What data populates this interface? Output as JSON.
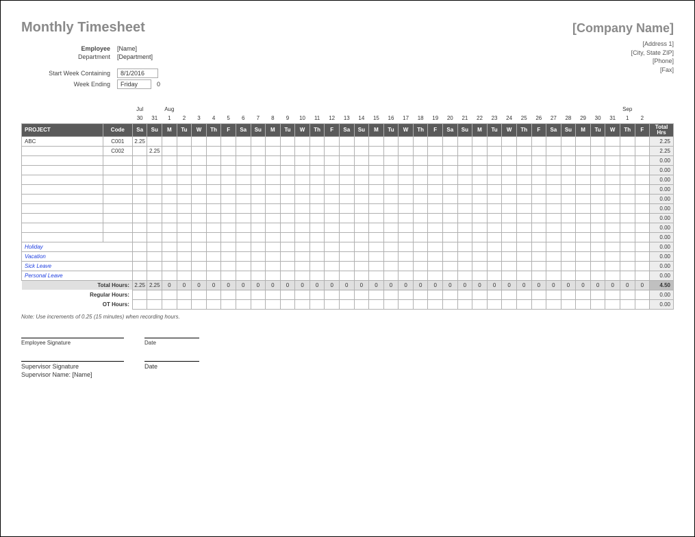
{
  "title": "Monthly Timesheet",
  "company": {
    "name": "[Company Name]",
    "address1": "[Address 1]",
    "citystatezip": "[City, State ZIP]",
    "phone": "[Phone]",
    "fax": "[Fax]"
  },
  "employee": {
    "label": "Employee",
    "value": "[Name]"
  },
  "department": {
    "label": "Department",
    "value": "[Department]"
  },
  "start_week": {
    "label": "Start Week Containing",
    "value": "8/1/2016"
  },
  "week_ending": {
    "label": "Week Ending",
    "value": "Friday",
    "extra": "0"
  },
  "months": {
    "jul": "Jul",
    "aug": "Aug",
    "sep": "Sep"
  },
  "day_numbers": [
    "30",
    "31",
    "1",
    "2",
    "3",
    "4",
    "5",
    "6",
    "7",
    "8",
    "9",
    "10",
    "11",
    "12",
    "13",
    "14",
    "15",
    "16",
    "17",
    "18",
    "19",
    "20",
    "21",
    "22",
    "23",
    "24",
    "25",
    "26",
    "27",
    "28",
    "29",
    "30",
    "31",
    "1",
    "2"
  ],
  "day_names": [
    "Sa",
    "Su",
    "M",
    "Tu",
    "W",
    "Th",
    "F",
    "Sa",
    "Su",
    "M",
    "Tu",
    "W",
    "Th",
    "F",
    "Sa",
    "Su",
    "M",
    "Tu",
    "W",
    "Th",
    "F",
    "Sa",
    "Su",
    "M",
    "Tu",
    "W",
    "Th",
    "F",
    "Sa",
    "Su",
    "M",
    "Tu",
    "W",
    "Th",
    "F"
  ],
  "hdr": {
    "project": "PROJECT",
    "code": "Code",
    "total": "Total Hrs"
  },
  "rows": [
    {
      "project": "ABC",
      "code": "C001",
      "cells": [
        "2.25",
        "",
        "",
        "",
        "",
        "",
        "",
        "",
        "",
        "",
        "",
        "",
        "",
        "",
        "",
        "",
        "",
        "",
        "",
        "",
        "",
        "",
        "",
        "",
        "",
        "",
        "",
        "",
        "",
        "",
        "",
        "",
        "",
        "",
        ""
      ],
      "total": "2.25"
    },
    {
      "project": "",
      "code": "C002",
      "cells": [
        "",
        "2.25",
        "",
        "",
        "",
        "",
        "",
        "",
        "",
        "",
        "",
        "",
        "",
        "",
        "",
        "",
        "",
        "",
        "",
        "",
        "",
        "",
        "",
        "",
        "",
        "",
        "",
        "",
        "",
        "",
        "",
        "",
        "",
        "",
        ""
      ],
      "total": "2.25"
    },
    {
      "project": "",
      "code": "",
      "cells": [
        "",
        "",
        "",
        "",
        "",
        "",
        "",
        "",
        "",
        "",
        "",
        "",
        "",
        "",
        "",
        "",
        "",
        "",
        "",
        "",
        "",
        "",
        "",
        "",
        "",
        "",
        "",
        "",
        "",
        "",
        "",
        "",
        "",
        "",
        ""
      ],
      "total": "0.00"
    },
    {
      "project": "",
      "code": "",
      "cells": [
        "",
        "",
        "",
        "",
        "",
        "",
        "",
        "",
        "",
        "",
        "",
        "",
        "",
        "",
        "",
        "",
        "",
        "",
        "",
        "",
        "",
        "",
        "",
        "",
        "",
        "",
        "",
        "",
        "",
        "",
        "",
        "",
        "",
        "",
        ""
      ],
      "total": "0.00"
    },
    {
      "project": "",
      "code": "",
      "cells": [
        "",
        "",
        "",
        "",
        "",
        "",
        "",
        "",
        "",
        "",
        "",
        "",
        "",
        "",
        "",
        "",
        "",
        "",
        "",
        "",
        "",
        "",
        "",
        "",
        "",
        "",
        "",
        "",
        "",
        "",
        "",
        "",
        "",
        "",
        ""
      ],
      "total": "0.00"
    },
    {
      "project": "",
      "code": "",
      "cells": [
        "",
        "",
        "",
        "",
        "",
        "",
        "",
        "",
        "",
        "",
        "",
        "",
        "",
        "",
        "",
        "",
        "",
        "",
        "",
        "",
        "",
        "",
        "",
        "",
        "",
        "",
        "",
        "",
        "",
        "",
        "",
        "",
        "",
        "",
        ""
      ],
      "total": "0.00"
    },
    {
      "project": "",
      "code": "",
      "cells": [
        "",
        "",
        "",
        "",
        "",
        "",
        "",
        "",
        "",
        "",
        "",
        "",
        "",
        "",
        "",
        "",
        "",
        "",
        "",
        "",
        "",
        "",
        "",
        "",
        "",
        "",
        "",
        "",
        "",
        "",
        "",
        "",
        "",
        "",
        ""
      ],
      "total": "0.00"
    },
    {
      "project": "",
      "code": "",
      "cells": [
        "",
        "",
        "",
        "",
        "",
        "",
        "",
        "",
        "",
        "",
        "",
        "",
        "",
        "",
        "",
        "",
        "",
        "",
        "",
        "",
        "",
        "",
        "",
        "",
        "",
        "",
        "",
        "",
        "",
        "",
        "",
        "",
        "",
        "",
        ""
      ],
      "total": "0.00"
    },
    {
      "project": "",
      "code": "",
      "cells": [
        "",
        "",
        "",
        "",
        "",
        "",
        "",
        "",
        "",
        "",
        "",
        "",
        "",
        "",
        "",
        "",
        "",
        "",
        "",
        "",
        "",
        "",
        "",
        "",
        "",
        "",
        "",
        "",
        "",
        "",
        "",
        "",
        "",
        "",
        ""
      ],
      "total": "0.00"
    },
    {
      "project": "",
      "code": "",
      "cells": [
        "",
        "",
        "",
        "",
        "",
        "",
        "",
        "",
        "",
        "",
        "",
        "",
        "",
        "",
        "",
        "",
        "",
        "",
        "",
        "",
        "",
        "",
        "",
        "",
        "",
        "",
        "",
        "",
        "",
        "",
        "",
        "",
        "",
        "",
        ""
      ],
      "total": "0.00"
    },
    {
      "project": "",
      "code": "",
      "cells": [
        "",
        "",
        "",
        "",
        "",
        "",
        "",
        "",
        "",
        "",
        "",
        "",
        "",
        "",
        "",
        "",
        "",
        "",
        "",
        "",
        "",
        "",
        "",
        "",
        "",
        "",
        "",
        "",
        "",
        "",
        "",
        "",
        "",
        "",
        ""
      ],
      "total": "0.00"
    }
  ],
  "leave_rows": [
    {
      "label": "Holiday",
      "total": "0.00"
    },
    {
      "label": "Vacation",
      "total": "0.00"
    },
    {
      "label": "Sick Leave",
      "total": "0.00"
    },
    {
      "label": "Personal Leave",
      "total": "0.00"
    }
  ],
  "totals": {
    "label_total": "Total Hours:",
    "row_total": [
      "2.25",
      "2.25",
      "0",
      "0",
      "0",
      "0",
      "0",
      "0",
      "0",
      "0",
      "0",
      "0",
      "0",
      "0",
      "0",
      "0",
      "0",
      "0",
      "0",
      "0",
      "0",
      "0",
      "0",
      "0",
      "0",
      "0",
      "0",
      "0",
      "0",
      "0",
      "0",
      "0",
      "0",
      "0",
      "0"
    ],
    "grand_total": "4.50",
    "label_regular": "Regular Hours:",
    "regular_total": "0.00",
    "label_ot": "OT Hours:",
    "ot_total": "0.00"
  },
  "note": "Note: Use increments of 0.25 (15 minutes) when recording hours.",
  "sig": {
    "emp": "Employee Signature",
    "date": "Date",
    "sup": "Supervisor Signature",
    "supname": "Supervisor Name: [Name]"
  }
}
